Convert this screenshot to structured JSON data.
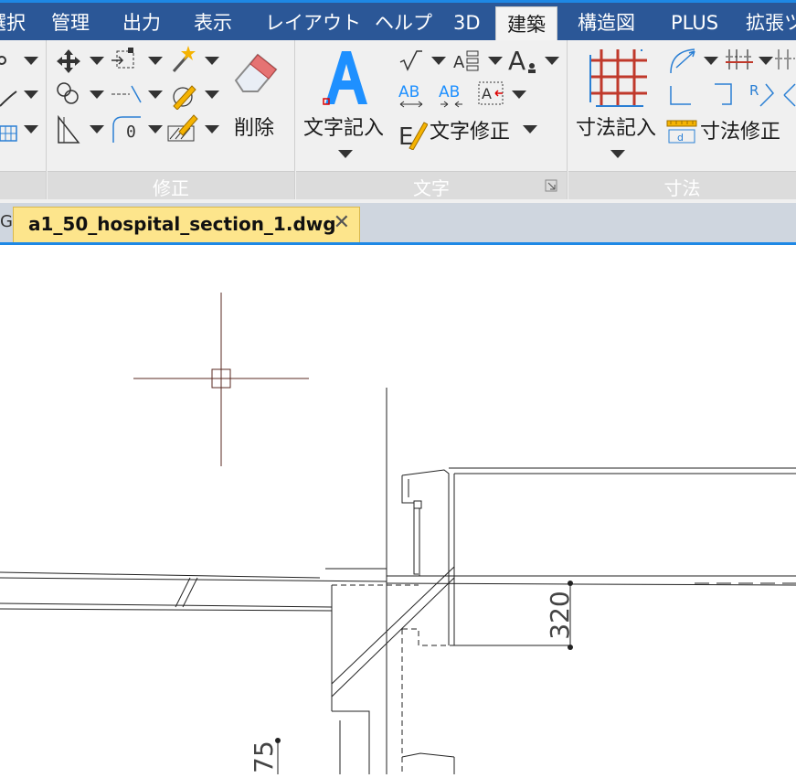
{
  "menu": {
    "items": [
      "選択",
      "管理",
      "出力",
      "表示",
      "レイアウト",
      "ヘルプ",
      "3D",
      "建築",
      "構造図",
      "PLUS",
      "拡張ツ"
    ],
    "active": "建築"
  },
  "ribbon": {
    "modify_panel": {
      "title": "修正",
      "delete_label": "削除",
      "radius_value": "0"
    },
    "text_panel": {
      "title": "文字",
      "text_entry_label": "文字記入",
      "text_edit_label": "文字修正"
    },
    "dimension_panel": {
      "title": "寸法",
      "dim_entry_label": "寸法記入",
      "dim_edit_label": "寸法修正"
    }
  },
  "tabs": {
    "prev_tab_fragment": "G",
    "active_tab": "a1_50_hospital_section_1.dwg",
    "close_glyph": "✕"
  },
  "drawing": {
    "dimension_values": [
      "320",
      "75"
    ]
  },
  "colors": {
    "menubar_bg": "#2b5797",
    "accent": "#1e88e5",
    "tab_active_bg": "#fde58c",
    "dimension_grid_red": "#c0392b"
  }
}
